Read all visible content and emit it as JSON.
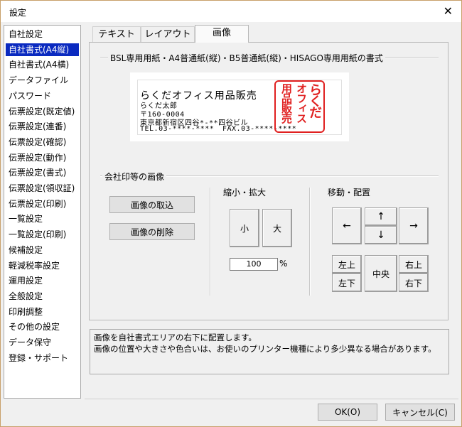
{
  "window": {
    "title": "設定",
    "close_glyph": "✕"
  },
  "sidebar": {
    "selected_index": 1,
    "items": [
      "自社設定",
      "自社書式(A4縦)",
      "自社書式(A4横)",
      "データファイル",
      "パスワード",
      "伝票設定(既定値)",
      "伝票設定(連番)",
      "伝票設定(確認)",
      "伝票設定(動作)",
      "伝票設定(書式)",
      "伝票設定(領収証)",
      "伝票設定(印刷)",
      "一覧設定",
      "一覧設定(印刷)",
      "候補設定",
      "軽減税率設定",
      "運用設定",
      "全般設定",
      "印刷調整",
      "その他の設定",
      "データ保守",
      "登録・サポート"
    ]
  },
  "tabs": {
    "text": "テキスト",
    "layout": "レイアウト",
    "image": "画像",
    "active": "image"
  },
  "format_group": {
    "label": "BSL専用用紙・A4普通紙(縦)・B5普通紙(縦)・HISAGO専用用紙の書式",
    "preview": {
      "company": "らくだオフィス用品販売",
      "person": "らくだ太郎",
      "postal": "〒160-0004",
      "address": "東京都新宿区四谷*-**四谷ビル",
      "phone": "TEL.03-****-****",
      "fax": "FAX.03-****-****",
      "stamp_columns": [
        "らくだ",
        "オフィス",
        "用品販売"
      ],
      "stamp_color": "#e02020"
    }
  },
  "image_group": {
    "label": "会社印等の画像",
    "import_button": "画像の取込",
    "delete_button": "画像の削除",
    "scale": {
      "label": "縮小・拡大",
      "shrink_button": "小",
      "enlarge_button": "大",
      "percent_value": "100",
      "percent_unit": "%"
    },
    "position": {
      "label": "移動・配置",
      "left_button": "←",
      "up_button": "↑",
      "down_button": "↓",
      "right_button": "→",
      "top_left_button": "左上",
      "bottom_left_button": "左下",
      "center_button": "中央",
      "top_right_button": "右上",
      "bottom_right_button": "右下"
    }
  },
  "info": {
    "line1": "画像を自社書式エリアの右下に配置します。",
    "line2": "画像の位置や大きさや色合いは、お使いのプリンター機種により多少異なる場合があります。"
  },
  "footer": {
    "ok_button": "OK(O)",
    "cancel_button": "キャンセル(C)"
  }
}
